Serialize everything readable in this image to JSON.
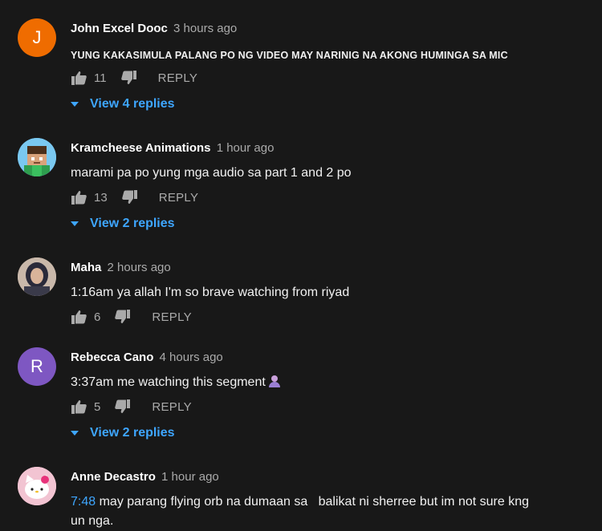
{
  "colors": {
    "background": "#181818",
    "text": "#f1f1f1",
    "secondary": "#aaaaaa",
    "link": "#3ea6ff"
  },
  "comments": [
    {
      "avatar_letter": "J",
      "avatar_color": "#ef6c00",
      "author": "John Excel Dooc",
      "time": "3 hours ago",
      "text": "YUNG KAKASIMULA PALANG PO NG VIDEO MAY NARINIG NA AKONG HUMINGA SA MIC",
      "likes": "11",
      "reply_label": "REPLY",
      "view_replies": "View 4 replies"
    },
    {
      "avatar_letter": "",
      "avatar_color": "#5ab4e8",
      "author": "Kramcheese Animations",
      "time": "1 hour ago",
      "text": "marami pa po yung mga audio sa part 1 and 2 po",
      "likes": "13",
      "reply_label": "REPLY",
      "view_replies": "View 2 replies"
    },
    {
      "avatar_letter": "",
      "avatar_color": "#b8a79a",
      "author": "Maha",
      "time": "2 hours ago",
      "text": "1:16am ya allah I'm so brave watching from riyad",
      "likes": "6",
      "reply_label": "REPLY",
      "view_replies": ""
    },
    {
      "avatar_letter": "R",
      "avatar_color": "#7e57c2",
      "author": "Rebecca Cano",
      "time": "4 hours ago",
      "text": "3:37am me watching this segment",
      "likes": "5",
      "reply_label": "REPLY",
      "view_replies": "View 2 replies"
    },
    {
      "avatar_letter": "",
      "avatar_color": "#e8a5b8",
      "author": "Anne Decastro",
      "time": "1 hour ago",
      "timestamp_link": "7:48",
      "text": " may parang flying orb na dumaan sa   balikat ni sherree but im not sure kng un nga."
    }
  ]
}
